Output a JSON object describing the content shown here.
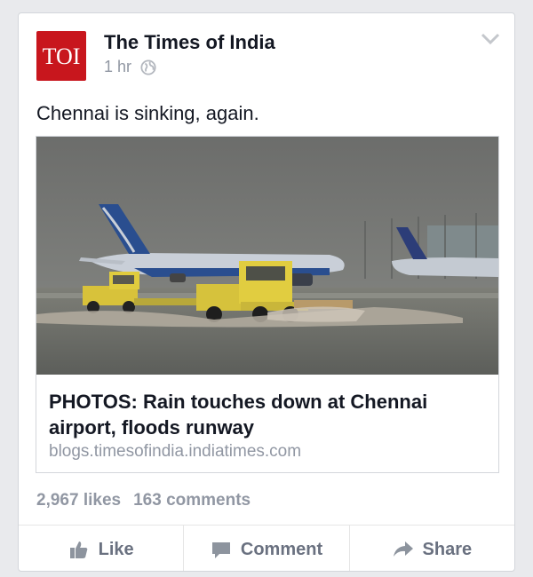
{
  "post": {
    "logo_text": "TOI",
    "page_name": "The Times of India",
    "time": "1 hr",
    "privacy_icon": "globe-icon",
    "status_text": "Chennai is sinking, again."
  },
  "link": {
    "title": "PHOTOS: Rain touches down at Chennai airport, floods runway",
    "domain": "blogs.timesofindia.indiatimes.com"
  },
  "stats": {
    "likes": "2,967 likes",
    "comments": "163 comments"
  },
  "actions": {
    "like": "Like",
    "comment": "Comment",
    "share": "Share"
  },
  "colors": {
    "brand_red": "#c8161d",
    "muted_text": "#9197a3",
    "action_text": "#6a7180"
  }
}
